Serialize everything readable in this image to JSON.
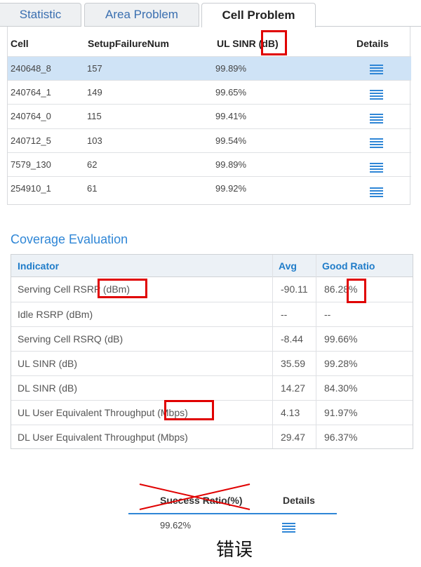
{
  "tabs": [
    {
      "label": "Statistic"
    },
    {
      "label": "Area Problem"
    },
    {
      "label": "Cell Problem"
    }
  ],
  "cell_problem": {
    "headers": {
      "cell": "Cell",
      "setup": "SetupFailureNum",
      "sinr_prefix": "UL SINR",
      "sinr_unit": "(dB)",
      "details": "Details"
    },
    "rows": [
      {
        "cell": "240648_8",
        "setup": "157",
        "sinr": "99.89%"
      },
      {
        "cell": "240764_1",
        "setup": "149",
        "sinr": "99.65%"
      },
      {
        "cell": "240764_0",
        "setup": "115",
        "sinr": "99.41%"
      },
      {
        "cell": "240712_5",
        "setup": "103",
        "sinr": "99.54%"
      },
      {
        "cell": "7579_130",
        "setup": "62",
        "sinr": "99.89%"
      },
      {
        "cell": "254910_1",
        "setup": "61",
        "sinr": "99.92%"
      }
    ]
  },
  "coverage": {
    "title": "Coverage Evaluation",
    "headers": {
      "indicator": "Indicator",
      "avg": "Avg",
      "good": "Good Ratio"
    },
    "rows": [
      {
        "indicator": "Serving Cell RSRP (dBm)",
        "avg": "-90.11",
        "good": "86.28%"
      },
      {
        "indicator": "Idle RSRP (dBm)",
        "avg": "--",
        "good": "--"
      },
      {
        "indicator": "Serving Cell RSRQ (dB)",
        "avg": "-8.44",
        "good": "99.66%"
      },
      {
        "indicator": "UL SINR (dB)",
        "avg": "35.59",
        "good": "99.28%"
      },
      {
        "indicator": "DL SINR (dB)",
        "avg": "14.27",
        "good": "84.30%"
      },
      {
        "indicator": "UL User Equivalent Throughput (Mbps)",
        "avg": "4.13",
        "good": "91.97%"
      },
      {
        "indicator": "DL User Equivalent Throughput (Mbps)",
        "avg": "29.47",
        "good": "96.37%"
      }
    ]
  },
  "success": {
    "header": "Success Ratio(%)",
    "details": "Details",
    "value": "99.62%"
  },
  "error_label": "错误",
  "colors": {
    "accent": "#2f86d6",
    "highlight": "#e00000",
    "selected_row": "#cfe3f6"
  }
}
